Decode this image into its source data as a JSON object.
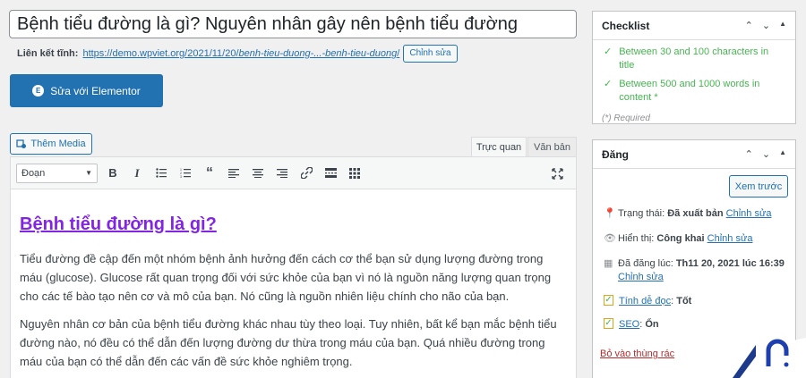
{
  "title": "Bệnh tiểu đường là gì? Nguyên nhân gây nên bệnh tiểu đường",
  "permalink": {
    "label": "Liên kết tĩnh:",
    "url_base": "https://demo.wpviet.org/2021/11/20/",
    "url_slug": "benh-tieu-duong-...-benh-tieu-duong",
    "url_end": "/",
    "edit_label": "Chỉnh sửa"
  },
  "elementor_button": "Sửa với Elementor",
  "add_media": "Thêm Media",
  "tabs": {
    "visual": "Trực quan",
    "text": "Văn bản"
  },
  "toolbar": {
    "format": "Đoạn"
  },
  "content": {
    "heading": "Bệnh tiểu đường là gì?",
    "paragraphs": [
      "Tiểu đường đề cập đến một nhóm bệnh ảnh hưởng đến cách cơ thể bạn sử dụng lượng đường trong máu (glucose). Glucose rất quan trọng đối với sức khỏe của bạn vì nó là nguồn năng lượng quan trọng cho các tế bào tạo nên cơ và mô của bạn. Nó cũng là nguồn nhiên liệu chính cho não của bạn.",
      "Nguyên nhân cơ bản của bệnh tiểu đường khác nhau tùy theo loại. Tuy nhiên, bất kể bạn mắc bệnh tiểu đường nào, nó đều có thể dẫn đến lượng đường dư thừa trong máu của bạn. Quá nhiều đường trong máu của bạn có thể dẫn đến các vấn đề sức khỏe nghiêm trọng."
    ]
  },
  "checklist": {
    "title": "Checklist",
    "items": [
      "Between 30 and 100 characters in title",
      "Between 500 and 1000 words in content *"
    ],
    "required_note": "(*) Required"
  },
  "publish": {
    "title": "Đăng",
    "preview": "Xem trước",
    "status_label": "Trạng thái:",
    "status_value": "Đã xuất bản",
    "visibility_label": "Hiển thị:",
    "visibility_value": "Công khai",
    "date_label": "Đã đăng lúc:",
    "date_value": "Th11 20, 2021 lúc 16:39",
    "readability_label": "Tính dễ đọc",
    "readability_value": "Tốt",
    "seo_label": "SEO",
    "seo_value": "Ổn",
    "edit": "Chỉnh sửa",
    "trash": "Bỏ vào thùng rác"
  },
  "colors": {
    "accent": "#2271b1",
    "check_green": "#46b450",
    "heading_purple": "#8224e3",
    "trash_red": "#b32d2e"
  }
}
